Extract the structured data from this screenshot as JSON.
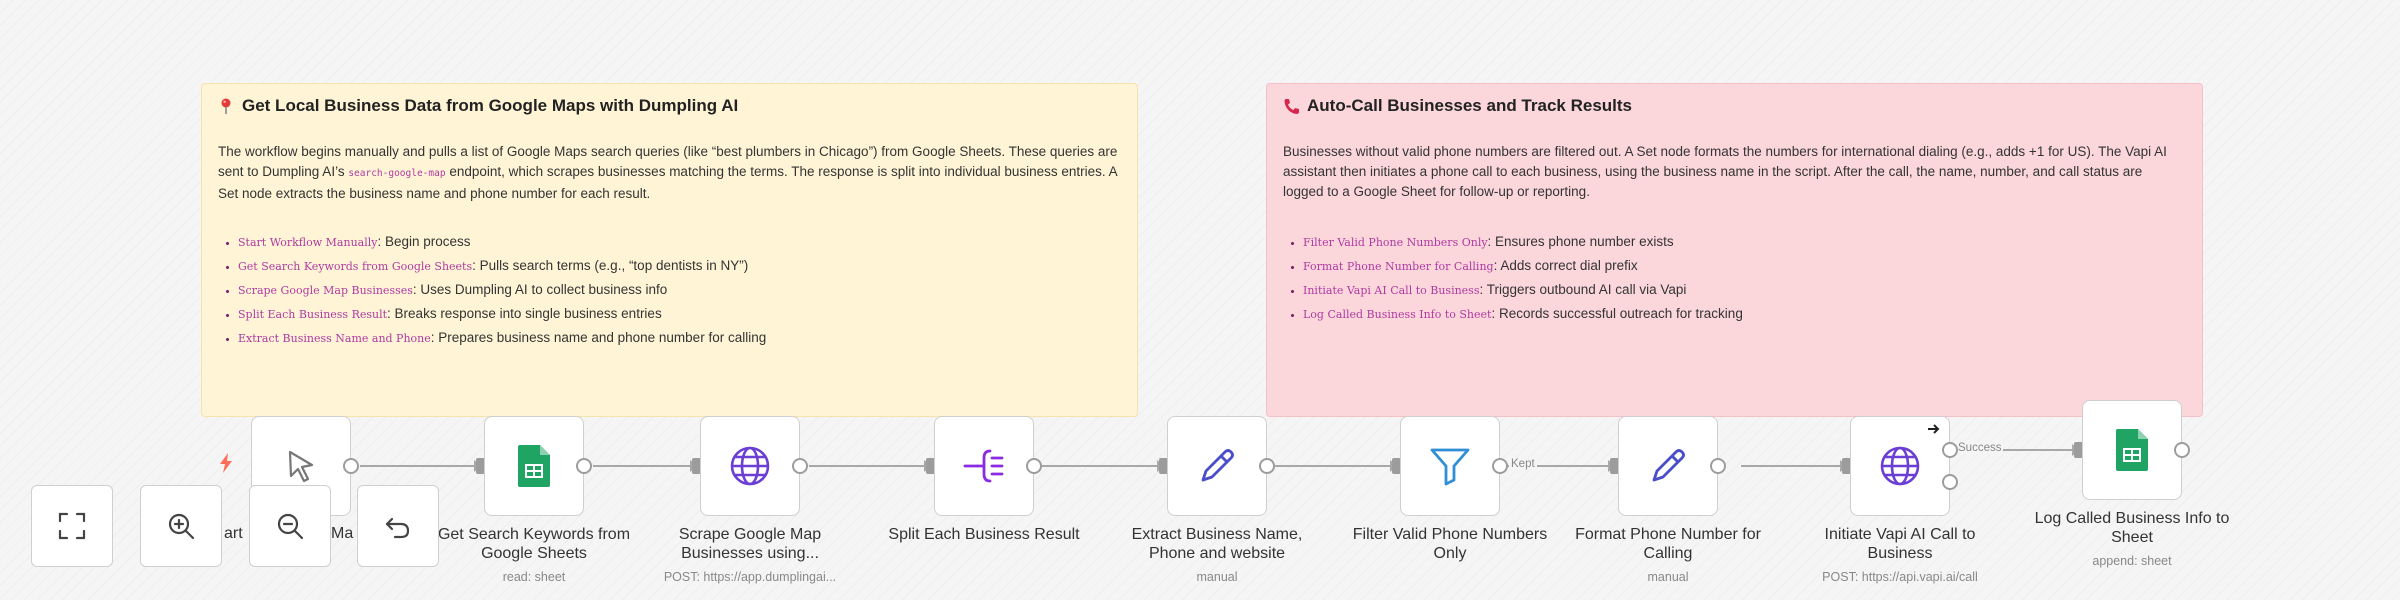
{
  "sticky_yellow": {
    "title": "Get Local Business Data from Google Maps with Dumpling AI",
    "icon": "pin-icon",
    "para_part1": "The workflow begins manually and pulls a list of Google Maps search queries (like “best plumbers in Chicago”) from Google Sheets. These queries are sent to Dumpling AI’s ",
    "para_code": "search-google-map",
    "para_part2": " endpoint, which scrapes businesses matching the terms. The response is split into individual business entries. A Set node extracts the business name and phone number for each result.",
    "items": [
      {
        "code": "Start Workflow Manually",
        "text": ": Begin process"
      },
      {
        "code": "Get Search Keywords from Google Sheets",
        "text": ": Pulls search terms (e.g., “top dentists in NY”)"
      },
      {
        "code": "Scrape Google Map Businesses",
        "text": ": Uses Dumpling AI to collect business info"
      },
      {
        "code": "Split Each Business Result",
        "text": ": Breaks response into single business entries"
      },
      {
        "code": "Extract Business Name and Phone",
        "text": ": Prepares business name and phone number for calling"
      }
    ]
  },
  "sticky_red": {
    "title": "Auto-Call Businesses and Track Results",
    "icon": "phone-icon",
    "para": "Businesses without valid phone numbers are filtered out. A Set node formats the numbers for international dialing (e.g., adds +1 for US). The Vapi AI assistant then initiates a phone call to each business, using the business name in the script. After the call, the name, number, and call status are logged to a Google Sheet for follow-up or reporting.",
    "items": [
      {
        "code": "Filter Valid Phone Numbers Only",
        "text": ": Ensures phone number exists"
      },
      {
        "code": "Format Phone Number for Calling",
        "text": ": Adds correct dial prefix"
      },
      {
        "code": "Initiate Vapi AI Call to Business",
        "text": ": Triggers outbound AI call via Vapi"
      },
      {
        "code": "Log Called Business Info to Sheet",
        "text": ": Records successful outreach for tracking"
      }
    ]
  },
  "nodes": [
    {
      "id": "start",
      "label_visible": "art",
      "label_visible2": "Ma",
      "icon": "cursor-icon"
    },
    {
      "id": "sheets-get",
      "label": "Get Search Keywords from Google Sheets",
      "sub": "read: sheet",
      "icon": "google-sheets-icon"
    },
    {
      "id": "scrape",
      "label": "Scrape Google Map Businesses using...",
      "sub": "POST: https://app.dumplingai...",
      "icon": "globe-icon"
    },
    {
      "id": "split",
      "label": "Split Each Business Result",
      "sub": "",
      "icon": "split-icon"
    },
    {
      "id": "extract",
      "label": "Extract Business Name, Phone and website",
      "sub": "manual",
      "icon": "pencil-icon"
    },
    {
      "id": "filter",
      "label": "Filter Valid Phone Numbers Only",
      "sub": "",
      "icon": "filter-icon"
    },
    {
      "id": "format",
      "label": "Format Phone Number for Calling",
      "sub": "manual",
      "icon": "pencil-icon"
    },
    {
      "id": "vapi",
      "label": "Initiate Vapi AI Call to Business",
      "sub": "POST: https://api.vapi.ai/call",
      "icon": "globe-icon"
    },
    {
      "id": "log",
      "label": "Log Called Business Info to Sheet",
      "sub": "append: sheet",
      "icon": "google-sheets-icon"
    }
  ],
  "edge_labels": {
    "kept": "Kept",
    "success": "Success"
  },
  "controls": [
    {
      "name": "fit-view-button",
      "icon": "fullscreen-icon"
    },
    {
      "name": "zoom-in-button",
      "icon": "zoom-in-icon"
    },
    {
      "name": "zoom-out-button",
      "icon": "zoom-out-icon"
    },
    {
      "name": "reset-zoom-button",
      "icon": "undo-icon"
    }
  ],
  "colors": {
    "sticky_yellow": "#fff5d6",
    "sticky_red": "#fbd7dc",
    "sheets_green": "#1fa463",
    "http_purple": "#6b3fd4",
    "split_purple": "#8a2be2",
    "edit_blue": "#4a4fc9",
    "filter_blue": "#2f8fd6",
    "trigger_orange": "#ff6d5a"
  }
}
